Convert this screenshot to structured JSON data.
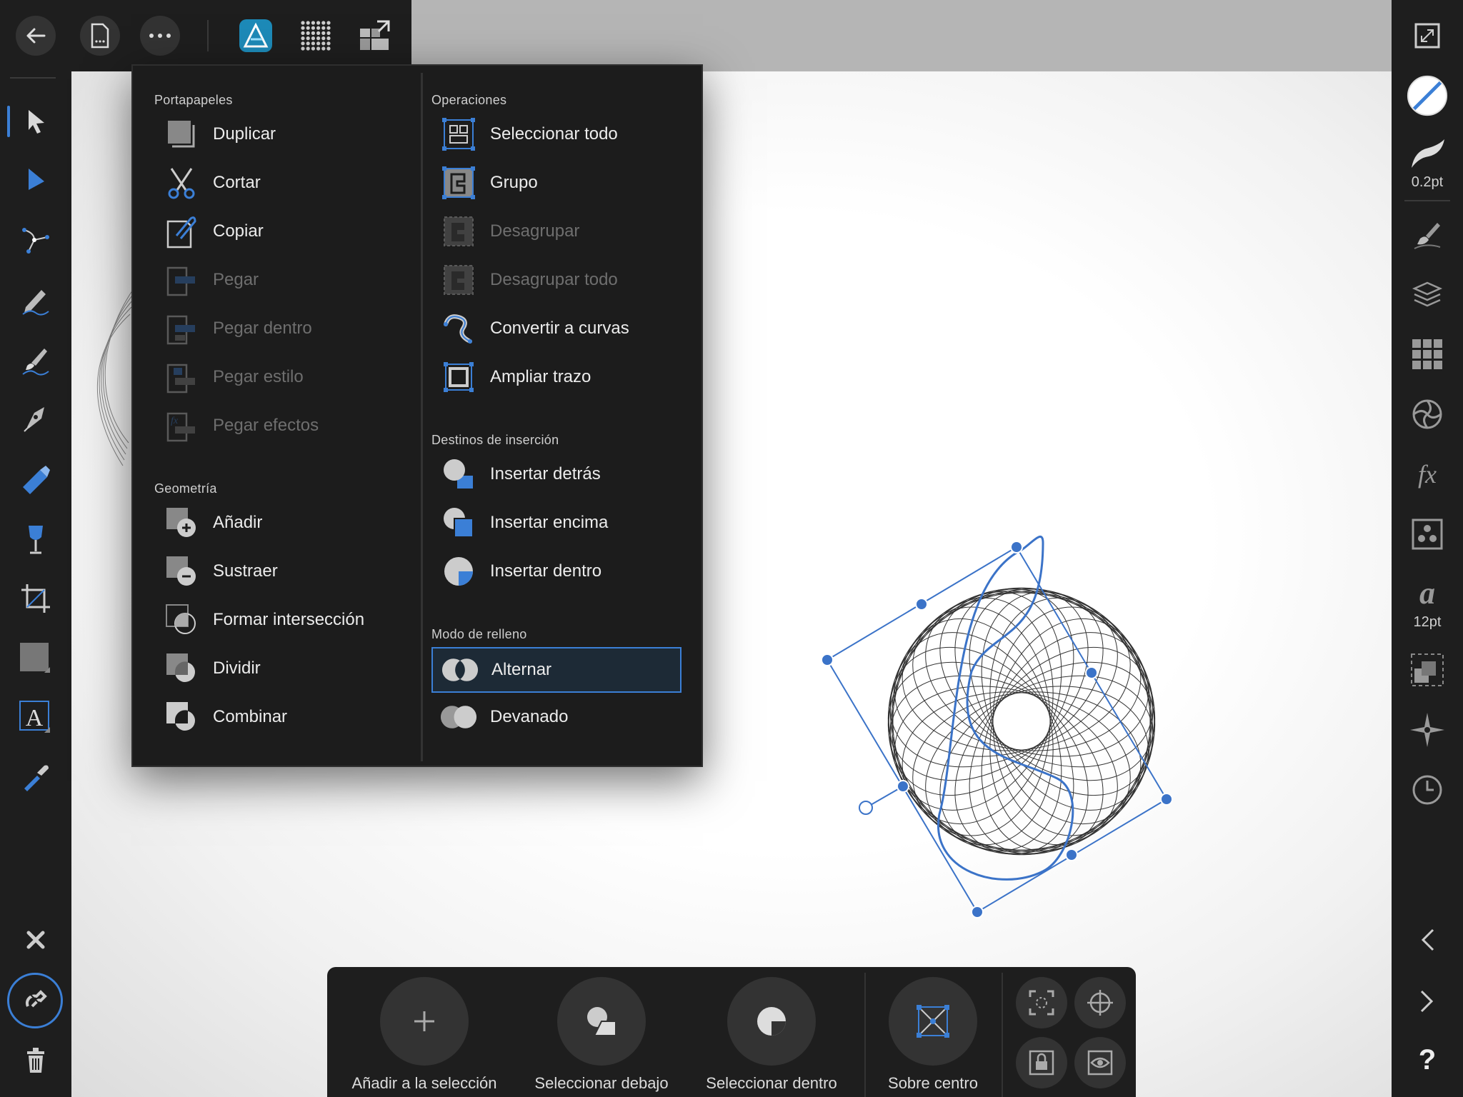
{
  "colors": {
    "accent": "#3b7fd6",
    "panel": "#1e1e1e",
    "popup": "#1c1c1c",
    "canvas_bg": "#b5b5b5",
    "artboard": "#ffffff",
    "selection": "#3b73c8"
  },
  "top_toolbar": {
    "icons": [
      "back-arrow-icon",
      "document-icon",
      "more-icon",
      "designer-persona-icon",
      "pixel-persona-icon",
      "export-persona-icon"
    ]
  },
  "left_toolbar": {
    "tools": [
      "move-tool-icon",
      "node-tool-icon",
      "point-transform-tool-icon",
      "pencil-tool-icon",
      "vector-brush-tool-icon",
      "pen-tool-icon",
      "fill-tool-icon",
      "transparency-tool-icon",
      "crop-tool-icon",
      "rectangle-tool-icon",
      "text-tool-icon",
      "color-picker-tool-icon"
    ],
    "bottom": [
      "close-icon",
      "snapping-magnet-icon",
      "trash-icon"
    ]
  },
  "right_toolbar": {
    "stroke_width": "0.2pt",
    "font_size": "12pt",
    "tools": [
      "fullscreen-icon",
      "color-swatch-icon",
      "stroke-icon",
      "brushes-icon",
      "layers-icon",
      "swatches-grid-icon",
      "adjustments-icon",
      "fx-icon",
      "assets-icon",
      "text-styles-icon",
      "transform-icon",
      "navigator-icon",
      "history-icon",
      "previous-icon",
      "next-icon",
      "help-icon"
    ]
  },
  "popup": {
    "left": {
      "clipboard_title": "Portapapeles",
      "clipboard_items": [
        {
          "label": "Duplicar",
          "icon": "duplicate-icon",
          "enabled": true
        },
        {
          "label": "Cortar",
          "icon": "scissors-icon",
          "enabled": true
        },
        {
          "label": "Copiar",
          "icon": "copy-icon",
          "enabled": true
        },
        {
          "label": "Pegar",
          "icon": "paste-icon",
          "enabled": false
        },
        {
          "label": "Pegar dentro",
          "icon": "paste-inside-icon",
          "enabled": false
        },
        {
          "label": "Pegar estilo",
          "icon": "paste-style-icon",
          "enabled": false
        },
        {
          "label": "Pegar efectos",
          "icon": "paste-effects-icon",
          "enabled": false
        }
      ],
      "geometry_title": "Geometría",
      "geometry_items": [
        {
          "label": "Añadir",
          "icon": "add-geometry-icon",
          "enabled": true
        },
        {
          "label": "Sustraer",
          "icon": "subtract-geometry-icon",
          "enabled": true
        },
        {
          "label": "Formar intersección",
          "icon": "intersect-geometry-icon",
          "enabled": true
        },
        {
          "label": "Dividir",
          "icon": "divide-geometry-icon",
          "enabled": true
        },
        {
          "label": "Combinar",
          "icon": "combine-geometry-icon",
          "enabled": true
        }
      ]
    },
    "right": {
      "operations_title": "Operaciones",
      "operations_items": [
        {
          "label": "Seleccionar todo",
          "icon": "select-all-icon",
          "enabled": true
        },
        {
          "label": "Grupo",
          "icon": "group-icon",
          "enabled": true
        },
        {
          "label": "Desagrupar",
          "icon": "ungroup-icon",
          "enabled": false
        },
        {
          "label": "Desagrupar todo",
          "icon": "ungroup-all-icon",
          "enabled": false
        },
        {
          "label": "Convertir a curvas",
          "icon": "convert-to-curves-icon",
          "enabled": true
        },
        {
          "label": "Ampliar trazo",
          "icon": "expand-stroke-icon",
          "enabled": true
        }
      ],
      "insertion_title": "Destinos de inserción",
      "insertion_items": [
        {
          "label": "Insertar detrás",
          "icon": "insert-behind-icon",
          "enabled": true
        },
        {
          "label": "Insertar encima",
          "icon": "insert-above-icon",
          "enabled": true
        },
        {
          "label": "Insertar dentro",
          "icon": "insert-inside-icon",
          "enabled": true
        }
      ],
      "fill_title": "Modo de relleno",
      "fill_items": [
        {
          "label": "Alternar",
          "icon": "alternate-fill-icon",
          "enabled": true,
          "selected": true
        },
        {
          "label": "Devanado",
          "icon": "winding-fill-icon",
          "enabled": true,
          "selected": false
        }
      ]
    }
  },
  "context_bar": {
    "add_to_selection": "Añadir a la selección",
    "select_behind": "Seleccionar debajo",
    "select_inside": "Seleccionar dentro",
    "about_center": "Sobre centro"
  }
}
